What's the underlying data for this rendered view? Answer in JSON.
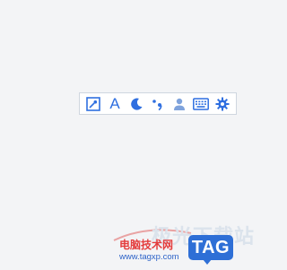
{
  "toolbar": {
    "items": [
      {
        "name": "handwriting-button",
        "icon": "handwriting-pad-icon"
      },
      {
        "name": "fullwidth-halfwidth-button",
        "icon": "letter-a-icon",
        "glyph": "A"
      },
      {
        "name": "mode-toggle-button",
        "icon": "crescent-moon-icon"
      },
      {
        "name": "punctuation-button",
        "icon": "punctuation-icon"
      },
      {
        "name": "user-account-button",
        "icon": "user-icon"
      },
      {
        "name": "soft-keyboard-button",
        "icon": "keyboard-icon"
      },
      {
        "name": "settings-button",
        "icon": "gear-icon"
      }
    ],
    "accent": "#2f6fe0"
  },
  "watermark": {
    "big_text": "极光下载站",
    "site_name": "电脑技术网",
    "url": "www.tagxp.com",
    "badge": "TAG",
    "badge_color": "#2e6fd6",
    "site_color": "#e43c3c"
  }
}
